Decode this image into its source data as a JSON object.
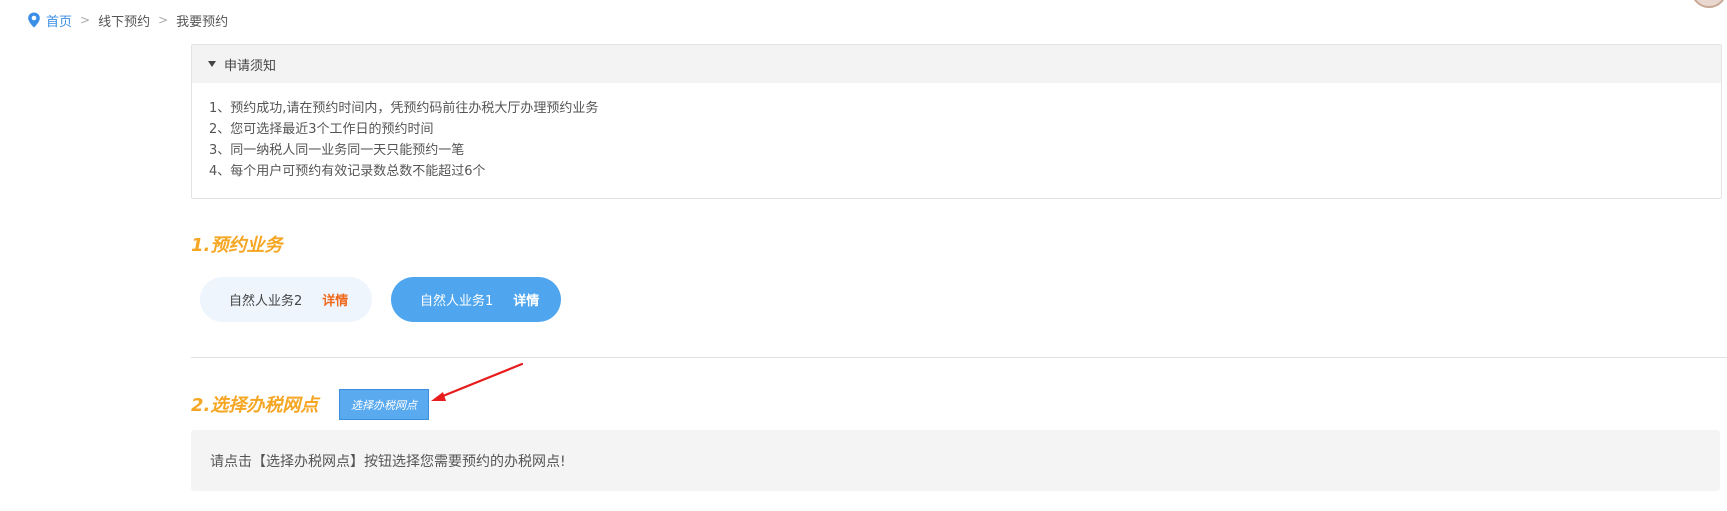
{
  "breadcrumb": {
    "icon": "location-pin-icon",
    "items": [
      "首页",
      "线下预约",
      "我要预约"
    ],
    "separator": ">"
  },
  "notice": {
    "title": "申请须知",
    "lines": [
      "1、预约成功,请在预约时间内，凭预约码前往办税大厅办理预约业务",
      "2、您可选择最近3个工作日的预约时间",
      "3、同一纳税人同一业务同一天只能预约一笔",
      "4、每个用户可预约有效记录数总数不能超过6个"
    ]
  },
  "section1": {
    "title": "1.预约业务",
    "services": [
      {
        "label": "自然人业务2",
        "detail": "详情",
        "selected": false
      },
      {
        "label": "自然人业务1",
        "detail": "详情",
        "selected": true
      }
    ]
  },
  "section2": {
    "title": "2.选择办税网点",
    "select_button": "选择办税网点",
    "hint": "请点击【选择办税网点】按钮选择您需要预约的办税网点!"
  },
  "colors": {
    "accent_orange": "#f5a623",
    "primary_blue": "#4fa6ee",
    "detail_red": "#f06a1b",
    "annotation_red": "#e81c1c"
  }
}
